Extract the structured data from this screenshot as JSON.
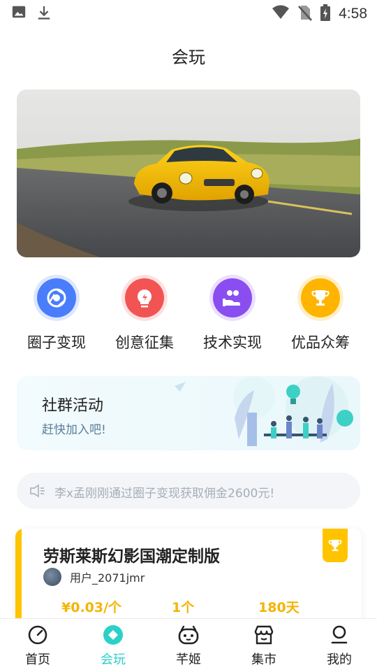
{
  "status_bar": {
    "time": "4:58"
  },
  "page": {
    "title": "会玩"
  },
  "features": [
    {
      "label": "圈子变现",
      "icon": "chrome-icon",
      "color": "#4a7dfb"
    },
    {
      "label": "创意征集",
      "icon": "lightbulb-icon",
      "color": "#f25454"
    },
    {
      "label": "技术实现",
      "icon": "hand-people-icon",
      "color": "#8a4ef0"
    },
    {
      "label": "优品众筹",
      "icon": "trophy-icon",
      "color": "#ffb400"
    }
  ],
  "community": {
    "title": "社群活动",
    "subtitle": "赶快加入吧!"
  },
  "notice": {
    "text": "李x孟刚刚通过圈子变现获取佣金2600元!"
  },
  "project_card": {
    "title": "劳斯莱斯幻影国潮定制版",
    "user": "用户_2071jmr",
    "price": "¥0.03/个",
    "count": "1个",
    "days": "180天"
  },
  "tabs": [
    {
      "label": "首页",
      "icon": "compass-icon",
      "active": false
    },
    {
      "label": "会玩",
      "icon": "diamond-icon",
      "active": true
    },
    {
      "label": "芊姬",
      "icon": "robot-face-icon",
      "active": false
    },
    {
      "label": "集市",
      "icon": "store-icon",
      "active": false
    },
    {
      "label": "我的",
      "icon": "person-icon",
      "active": false
    }
  ],
  "colors": {
    "accent": "#2ad1c6",
    "gold": "#ffc400"
  }
}
